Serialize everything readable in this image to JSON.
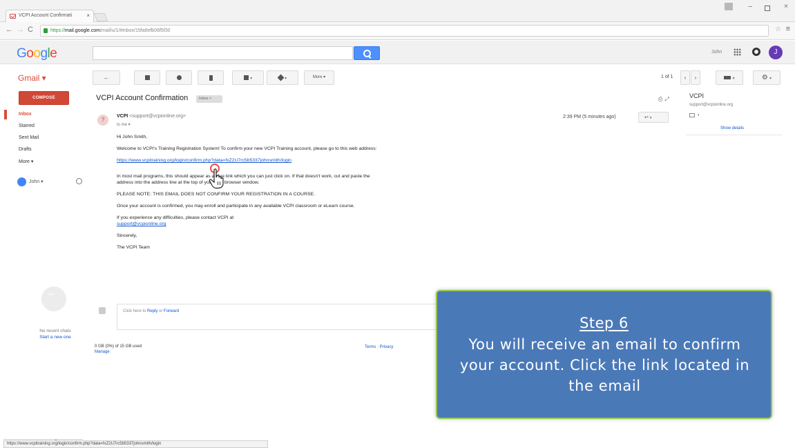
{
  "browser": {
    "tab_title": "VCPI Account Confirmati",
    "tab_close": "×",
    "url_scheme": "https://",
    "url_host": "mail.google.com",
    "url_path": "/mail/u/1/#inbox/15fa6efb06f5f30",
    "nav_back": "←",
    "nav_forward": "→",
    "nav_reload": "C",
    "star": "☆",
    "menu": "≡",
    "window_min": "–",
    "window_close": "×"
  },
  "google": {
    "logo": [
      "G",
      "o",
      "o",
      "g",
      "l",
      "e"
    ],
    "user_name": "John",
    "avatar_letter": "J"
  },
  "gmail": {
    "label": "Gmail ▾",
    "toolbar": {
      "back": "←",
      "more": "More ▾"
    },
    "pager": "1 of 1",
    "compose": "COMPOSE",
    "nav": [
      "Inbox",
      "Starred",
      "Sent Mail",
      "Drafts",
      "More ▾"
    ],
    "hangout_user": "John ▾",
    "no_chats": "No recent chats",
    "start_chat": "Start a new one",
    "storage": "0 GB (0%) of 15 GB used",
    "manage": "Manage",
    "terms": "Terms · Privacy",
    "reply_prompt_pre": "Click here to ",
    "reply_prompt_reply": "Reply",
    "reply_prompt_mid": " or ",
    "reply_prompt_forward": "Forward"
  },
  "message": {
    "subject": "VCPI Account Confirmation",
    "label": "Inbox ×",
    "sender_initial": "?",
    "sender_name": "VCPI",
    "sender_email": "<support@vcpionline.org>",
    "to": "to me ▾",
    "time": "2:39 PM (5 minutes ago)",
    "greeting": "Hi John Smith,",
    "para1": "Welcome to VCPI's Training Registration System! To confirm your new VCPI Training account, please go to this web address:",
    "link": "https://www.vcpitraining.org/login/confirm.php?data=fxZ2U7rc5b5337johnsmith/login",
    "para2": "In most mail programs, this should appear as a blue link which you can just click on. If that doesn't work, cut and paste the address into the address line at the top of your web browser window.",
    "note": "PLEASE NOTE: THIS EMAIL DOES NOT CONFIRM YOUR REGISTRATION IN A COURSE.",
    "para3": "Once your account is confirmed, you may enroll and participate in any available VCPI classroom or eLearn course.",
    "para4": "If you experience any difficulties, please contact VCPI at",
    "support_link": "support@vcpionline.org",
    "signoff": "Sincerely,",
    "team": "The VCPI Team"
  },
  "contact_card": {
    "name": "VCPI",
    "email": "support@vcpionline.org",
    "show_details": "Show details"
  },
  "status_url": "https://www.vcpitraining.org/login/confirm.php?data=fxZ2U7rc5b5337johnsmith/login",
  "callout": {
    "step": "Step 6",
    "text": "You will receive an email to confirm your account. Click the link located in the email",
    "background": "#4a79b8",
    "border": "#95c94b"
  }
}
